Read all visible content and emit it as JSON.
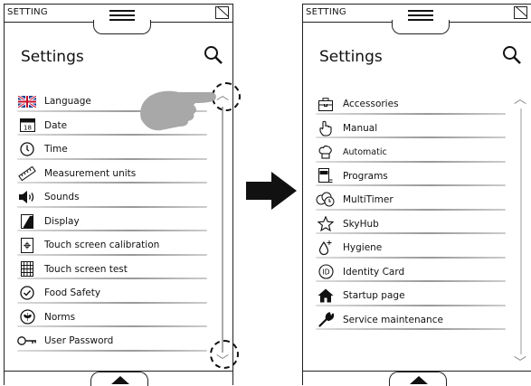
{
  "left_panel": {
    "header": "SETTING",
    "title": "Settings",
    "items": [
      {
        "label": "Language",
        "icon": "uk-flag-icon"
      },
      {
        "label": "Date",
        "icon": "calendar-icon"
      },
      {
        "label": "Time",
        "icon": "clock-icon"
      },
      {
        "label": "Measurement units",
        "icon": "ruler-icon"
      },
      {
        "label": "Sounds",
        "icon": "speaker-icon"
      },
      {
        "label": "Display",
        "icon": "display-icon"
      },
      {
        "label": "Touch screen calibration",
        "icon": "calibration-icon"
      },
      {
        "label": "Touch screen test",
        "icon": "grid-icon"
      },
      {
        "label": "Food Safety",
        "icon": "check-circle-icon"
      },
      {
        "label": "Norms",
        "icon": "norms-icon"
      },
      {
        "label": "User Password",
        "icon": "key-icon"
      }
    ],
    "date_icon_text": "18"
  },
  "right_panel": {
    "header": "SETTING",
    "title": "Settings",
    "items": [
      {
        "label": "Accessories",
        "icon": "toolbox-icon"
      },
      {
        "label": "Manual",
        "icon": "hand-pointer-icon"
      },
      {
        "label": "Automatic",
        "icon": "chef-hat-icon"
      },
      {
        "label": "Programs",
        "icon": "programs-icon"
      },
      {
        "label": "MultiTimer",
        "icon": "multitimer-icon"
      },
      {
        "label": "SkyHub",
        "icon": "star-icon"
      },
      {
        "label": "Hygiene",
        "icon": "drop-icon"
      },
      {
        "label": "Identity Card",
        "icon": "id-icon"
      },
      {
        "label": "Startup page",
        "icon": "home-icon"
      },
      {
        "label": "Service maintenance",
        "icon": "wrench-icon"
      }
    ],
    "id_icon_text": "ID"
  }
}
